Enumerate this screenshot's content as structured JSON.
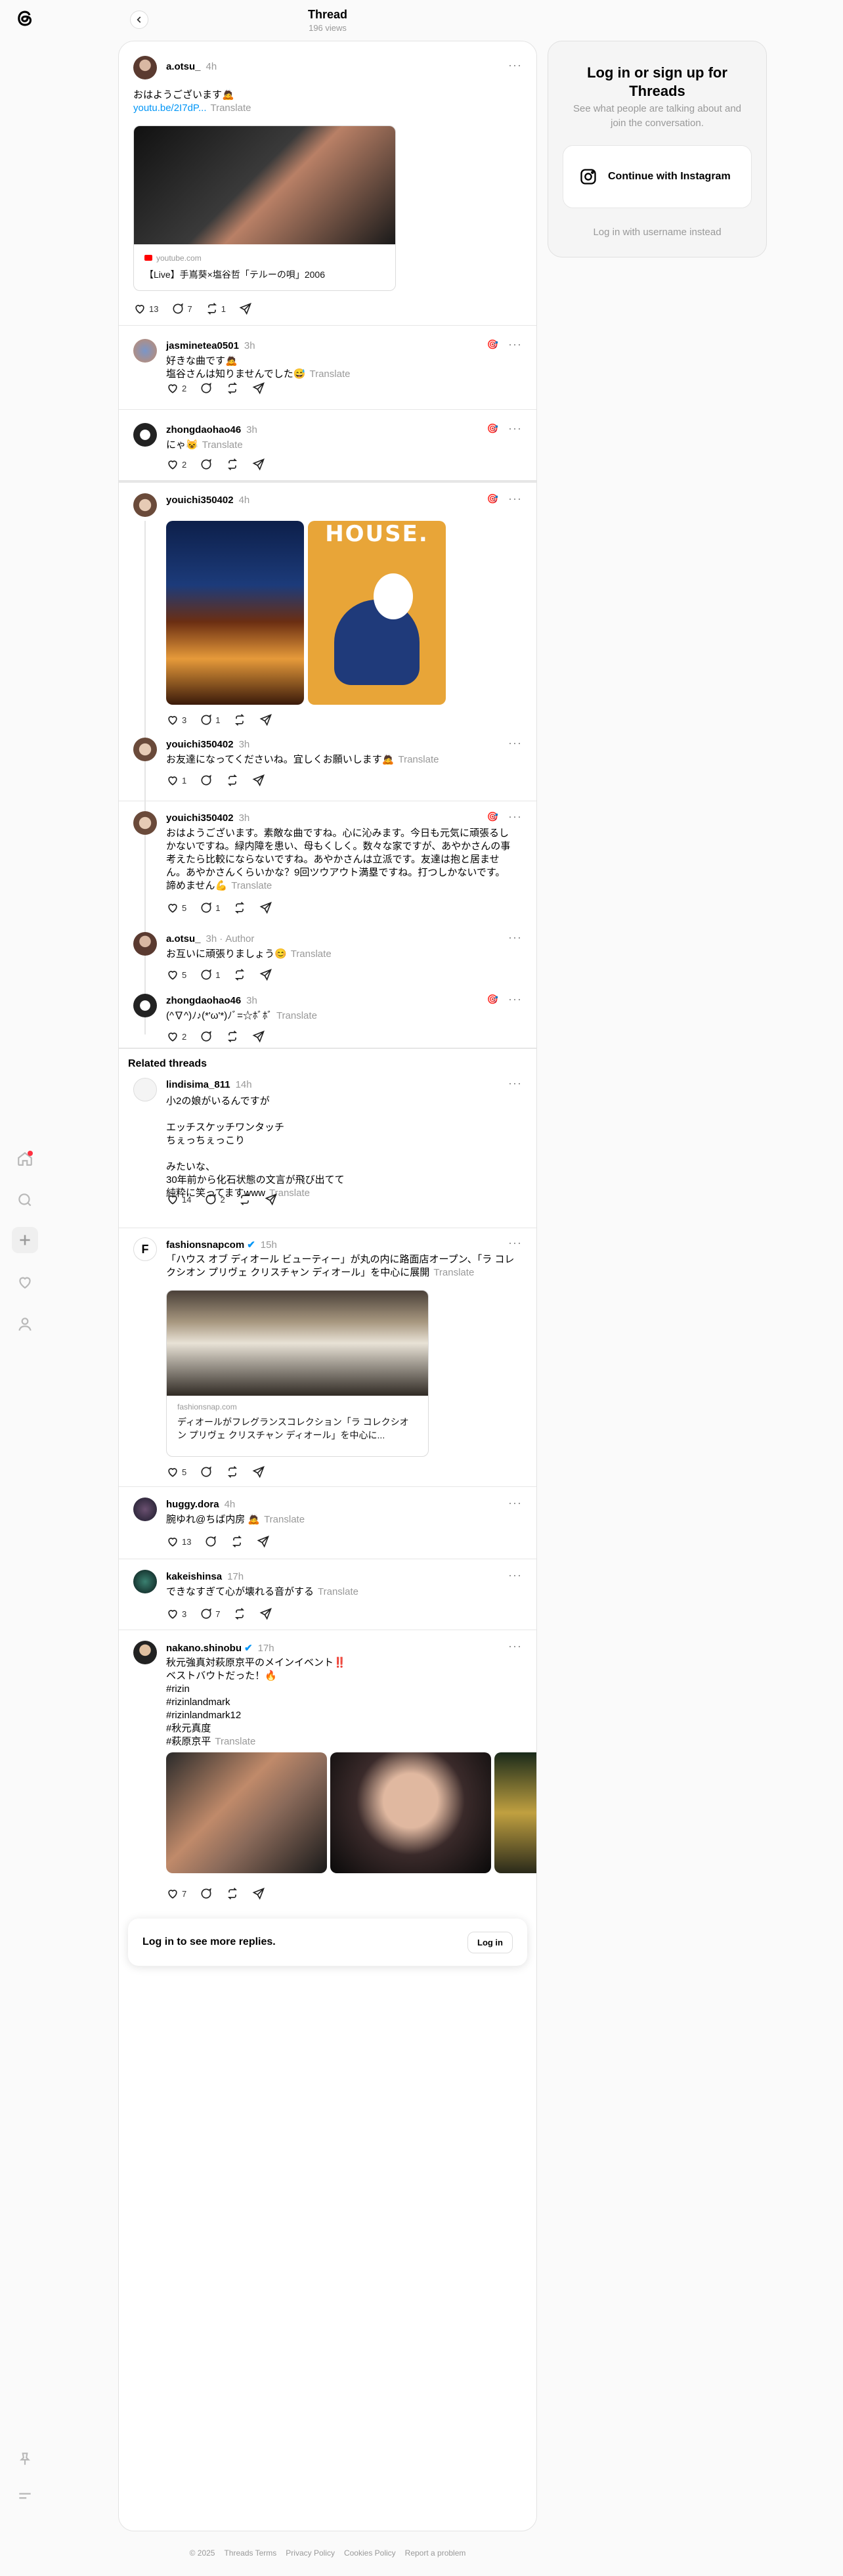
{
  "header": {
    "title": "Thread",
    "views": "196 views"
  },
  "main_post": {
    "username": "a.otsu_",
    "time": "4h",
    "text": "おはようございます🙇",
    "link": "youtu.be/2I7dP...",
    "translate": "Translate",
    "card_source": "youtube.com",
    "card_title": "【Live】手嶌葵×塩谷哲「テルーの唄」2006",
    "likes": "13",
    "replies": "7",
    "reposts": "1"
  },
  "replies": [
    {
      "username": "jasminetea0501",
      "time": "3h",
      "text": "好きな曲です🙇\n塩谷さんは知りませんでした😅",
      "translate": "Translate",
      "likes": "2",
      "replies": "",
      "reposts": ""
    },
    {
      "username": "zhongdaohao46",
      "time": "3h",
      "text": "にゃ😺",
      "translate": "Translate",
      "likes": "2",
      "replies": "",
      "reposts": ""
    },
    {
      "username": "youichi350402",
      "time": "4h",
      "likes": "3",
      "replies": "1",
      "reposts": ""
    },
    {
      "username": "youichi350402",
      "time": "3h",
      "text": "お友達になってくださいね。宜しくお願いします🙇",
      "translate": "Translate",
      "likes": "1",
      "replies": "",
      "reposts": ""
    },
    {
      "username": "youichi350402",
      "time": "3h",
      "text": "おはようございます。素敵な曲ですね。心に沁みます。今日も元気に頑張るしかないですね。緑内障を患い、母もくしく。数々な家ですが、あやかさんの事考えたら比較にならないですね。あやかさんは立派です。友達は抱と居ません。あやかさんくらいかな？9回ツウアウト満塁ですね。打つしかないです。諦めません💪",
      "translate": "Translate",
      "likes": "5",
      "replies": "1",
      "reposts": ""
    },
    {
      "username": "a.otsu_",
      "time": "3h",
      "author": "Author",
      "text": "お互いに頑張りましょう😊",
      "translate": "Translate",
      "likes": "5",
      "replies": "1",
      "reposts": ""
    },
    {
      "username": "zhongdaohao46",
      "time": "3h",
      "text": "(^∇^)ﾉ♪(*'ω'*)ﾉﾞ=☆ﾎﾞﾎﾞ",
      "translate": "Translate",
      "likes": "2",
      "replies": "",
      "reposts": ""
    }
  ],
  "related": {
    "heading": "Related threads",
    "items": [
      {
        "username": "lindisima_811",
        "time": "14h",
        "text": "小2の娘がいるんですが\n\nエッチスケッチワンタッチ\nちぇっちぇっこり\n\nみたいな、\n30年前から化石状態の文言が飛び出てて\n純粋に笑ってますwww",
        "translate": "Translate",
        "likes": "14",
        "replies": "2",
        "reposts": ""
      },
      {
        "username": "fashionsnapcom",
        "time": "15h",
        "text": "「ハウス オブ ディオール ビューティー」が丸の内に路面店オープン、「ラ コレクシオン プリヴェ クリスチャン ディオール」を中心に展開",
        "translate": "Translate",
        "card_source": "fashionsnap.com",
        "card_title": "ディオールがフレグランスコレクション「ラ コレクシオン プリヴェ クリスチャン ディオール」を中心に...",
        "likes": "5",
        "replies": "",
        "reposts": ""
      },
      {
        "username": "huggy.dora",
        "time": "4h",
        "text": "腕ゆれ@ちば内房 🙇",
        "translate": "Translate",
        "likes": "13",
        "replies": "",
        "reposts": ""
      },
      {
        "username": "kakeishinsa",
        "time": "17h",
        "text": "できなすぎて心が壊れる音がする",
        "translate": "Translate",
        "likes": "3",
        "replies": "7",
        "reposts": ""
      },
      {
        "username": "nakano.shinobu",
        "time": "17h",
        "text": "秋元強真対萩原京平のメインイベント‼️\nベストバウトだった！🔥\n#rizin\n#rizinlandmark\n#rizinlandmark12\n#秋元真度\n#萩原京平",
        "translate": "Translate",
        "likes": "7",
        "replies": "",
        "reposts": ""
      }
    ]
  },
  "login_bar": {
    "text": "Log in to see more replies.",
    "button": "Log in"
  },
  "right_panel": {
    "title": "Log in or sign up for Threads",
    "subtitle": "See what people are talking about and join the conversation.",
    "button": "Continue with Instagram",
    "alt": "Log in with username instead"
  },
  "footer": {
    "copyright": "© 2025",
    "links": [
      "Threads Terms",
      "Privacy Policy",
      "Cookies Policy",
      "Report a problem"
    ]
  },
  "icons": {
    "like": "heart-icon",
    "reply": "comment-icon",
    "repost": "repost-icon",
    "share": "share-icon"
  }
}
